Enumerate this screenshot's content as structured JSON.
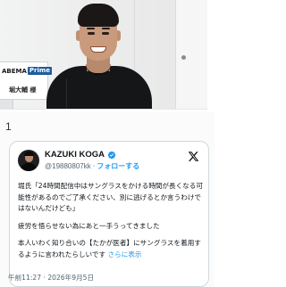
{
  "photo": {
    "plate_brand": "ABEMA",
    "plate_badge": "Prime",
    "plate_name": "堀大輔 様"
  },
  "section": {
    "number": "1"
  },
  "tweet": {
    "display_name": "KAZUKI KOGA",
    "handle": "@19880807kk",
    "separator": "·",
    "follow_label": "フォローする",
    "paragraph_1": "堀氏「24時間配信中はサングラスをかける時間が長くなる可能性があるのでご了承ください、別に逃げるとか言うわけではないんだけども」",
    "paragraph_2": "疲労を悟らせない為にあと一手うってきました",
    "paragraph_3": "本人いわく知り合いの【たかが医者】にサングラスを着用するように言われたらしいです",
    "show_more": "さらに表示",
    "timestamp": "午前11:27 · 2026年9月5日",
    "icons": {
      "verified": "verified-badge-icon",
      "platform": "x-logo-icon"
    },
    "colors": {
      "link": "#1d9bf0",
      "secondary_text": "#536471",
      "primary_text": "#0f1419"
    }
  }
}
